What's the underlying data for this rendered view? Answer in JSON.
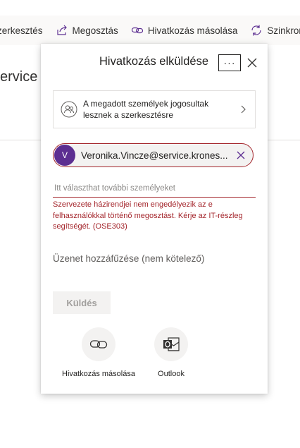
{
  "toolbar": {
    "edit_label": "zerkesztés",
    "share_label": "Megosztás",
    "copy_link_label": "Hivatkozás másolása",
    "sync_label": "Szinkronizá"
  },
  "background": {
    "title_fragment": "ervice"
  },
  "dialog": {
    "title": "Hivatkozás elküldése",
    "more_label": "···",
    "permission_text": "A megadott személyek jogosultak lesznek a szerkesztésre",
    "recipient": {
      "initial": "V",
      "name": "Veronika.Vincze@service.krones..."
    },
    "add_people_placeholder": "Itt választhat további személyeket",
    "error_text": "Szervezete házirendjei nem engedélyezik az e felhasználókkal történő megosztást. Kérje az IT-részleg segítségét. (OSE303)",
    "message_placeholder": "Üzenet hozzáfűzése (nem kötelező)",
    "send_label": "Küldés",
    "share_options": [
      {
        "label": "Hivatkozás másolása",
        "icon": "link-icon"
      },
      {
        "label": "Outlook",
        "icon": "outlook-icon"
      }
    ]
  },
  "colors": {
    "error": "#a4262c",
    "avatar": "#5c2e91",
    "accent": "#5c2e91"
  }
}
